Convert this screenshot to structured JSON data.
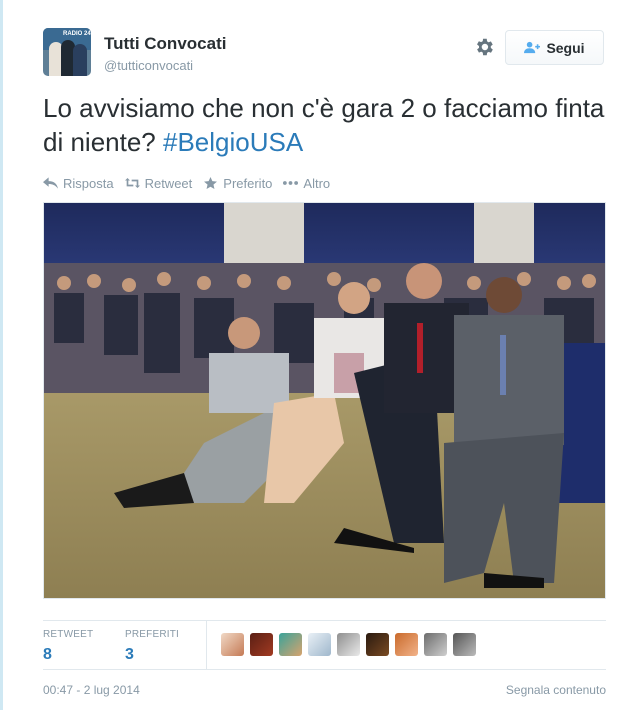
{
  "author": {
    "name": "Tutti Convocati",
    "handle": "@tutticonvocati",
    "avatar_icon": "profile-photo",
    "avatar_text": "RADIO 24"
  },
  "header": {
    "settings_icon": "gear-icon",
    "follow_label": "Segui",
    "follow_icon": "add-user-icon"
  },
  "tweet": {
    "text": "Lo avvisiamo che non c'è gara 2 o facciamo finta di niente?",
    "hashtag": "#BelgioUSA"
  },
  "actions": {
    "reply_label": "Risposta",
    "retweet_label": "Retweet",
    "favorite_label": "Preferito",
    "more_label": "Altro"
  },
  "stats": {
    "retweets_label": "RETWEET",
    "retweets_count": "8",
    "favorites_label": "PREFERITI",
    "favorites_count": "3"
  },
  "footer": {
    "timestamp": "00:47 - 2 lug 2014",
    "report_label": "Segnala contenuto"
  },
  "colors": {
    "link": "#2b7bb9",
    "muted": "#8899a6",
    "text": "#292f33"
  }
}
